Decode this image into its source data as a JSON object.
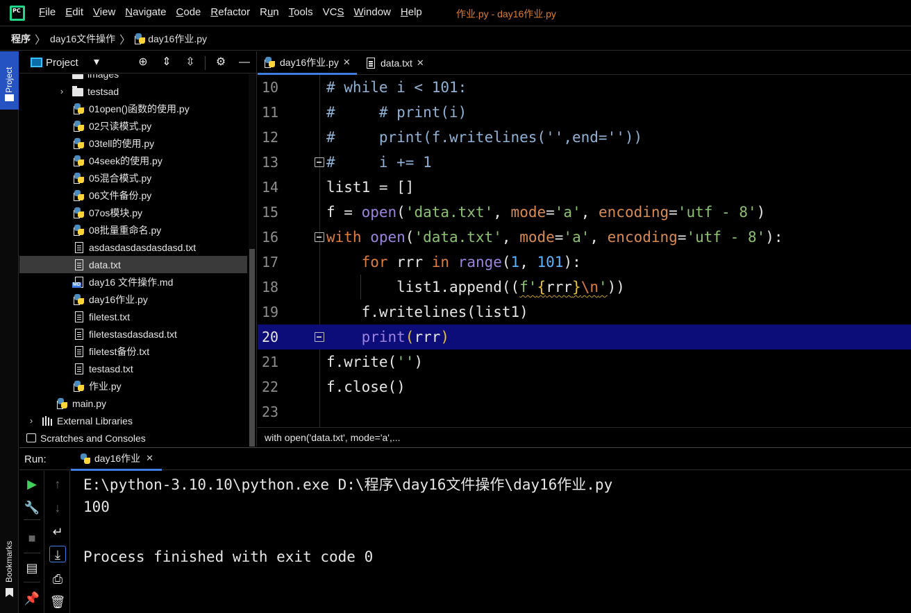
{
  "menu": {
    "logo": "PC",
    "items": [
      {
        "pre": "",
        "u": "F",
        "post": "ile"
      },
      {
        "pre": "",
        "u": "E",
        "post": "dit"
      },
      {
        "pre": "",
        "u": "V",
        "post": "iew"
      },
      {
        "pre": "",
        "u": "N",
        "post": "avigate"
      },
      {
        "pre": "",
        "u": "C",
        "post": "ode"
      },
      {
        "pre": "",
        "u": "R",
        "post": "efactor"
      },
      {
        "pre": "R",
        "u": "u",
        "post": "n"
      },
      {
        "pre": "",
        "u": "T",
        "post": "ools"
      },
      {
        "pre": "VC",
        "u": "S",
        "post": ""
      },
      {
        "pre": "",
        "u": "W",
        "post": "indow"
      },
      {
        "pre": "",
        "u": "H",
        "post": "elp"
      }
    ],
    "window_title": "作业.py - day16作业.py"
  },
  "breadcrumb": {
    "items": [
      "程序",
      "day16文件操作",
      "day16作业.py"
    ]
  },
  "sidebar": {
    "project_tab": "Project",
    "bookmarks_tab": "Bookmarks"
  },
  "project_panel": {
    "title": "Project",
    "tree": [
      {
        "label": "images",
        "type": "folder",
        "indent": 1,
        "arrow": "",
        "partial": true
      },
      {
        "label": "testsad",
        "type": "folder",
        "indent": 1,
        "arrow": "›"
      },
      {
        "label": "01open()函数的使用.py",
        "type": "py",
        "indent": 2
      },
      {
        "label": "02只读模式.py",
        "type": "py",
        "indent": 2
      },
      {
        "label": "03tell的使用.py",
        "type": "py",
        "indent": 2
      },
      {
        "label": "04seek的使用.py",
        "type": "py",
        "indent": 2
      },
      {
        "label": "05混合模式.py",
        "type": "py",
        "indent": 2
      },
      {
        "label": "06文件备份.py",
        "type": "py",
        "indent": 2
      },
      {
        "label": "07os模块.py",
        "type": "py",
        "indent": 2
      },
      {
        "label": "08批量重命名.py",
        "type": "py",
        "indent": 2
      },
      {
        "label": "asdasdasdasdasdasd.txt",
        "type": "txt",
        "indent": 2
      },
      {
        "label": "data.txt",
        "type": "txt",
        "indent": 2,
        "selected": true
      },
      {
        "label": "day16 文件操作.md",
        "type": "md",
        "indent": 2
      },
      {
        "label": "day16作业.py",
        "type": "py",
        "indent": 2
      },
      {
        "label": "filetest.txt",
        "type": "txt",
        "indent": 2
      },
      {
        "label": "filetestasdasdasd.txt",
        "type": "txt",
        "indent": 2
      },
      {
        "label": "filetest备份.txt",
        "type": "txt",
        "indent": 2
      },
      {
        "label": "testasd.txt",
        "type": "txt",
        "indent": 2
      },
      {
        "label": "作业.py",
        "type": "py",
        "indent": 2
      },
      {
        "label": "main.py",
        "type": "py",
        "indent": 1
      },
      {
        "label": "External Libraries",
        "type": "lib",
        "indent": 0,
        "arrow": "›"
      },
      {
        "label": "Scratches and Consoles",
        "type": "scratch",
        "indent": 0
      }
    ]
  },
  "editor": {
    "tabs": [
      {
        "label": "day16作业.py",
        "icon": "python-file-icon",
        "active": true
      },
      {
        "label": "data.txt",
        "icon": "text-file-icon",
        "active": false
      }
    ],
    "lines": [
      {
        "n": "10",
        "fold": false,
        "tokens": [
          [
            "c-comment",
            "# while i < 101:"
          ]
        ]
      },
      {
        "n": "11",
        "fold": false,
        "tokens": [
          [
            "c-comment",
            "#     # print(i)"
          ]
        ]
      },
      {
        "n": "12",
        "fold": false,
        "tokens": [
          [
            "c-comment",
            "#     print(f.writelines('',end=''))"
          ]
        ]
      },
      {
        "n": "13",
        "fold": true,
        "tokens": [
          [
            "c-comment",
            "#     i += 1"
          ]
        ]
      },
      {
        "n": "14",
        "fold": false,
        "tokens": [
          [
            "",
            "list1 = []"
          ]
        ]
      },
      {
        "n": "15",
        "fold": false,
        "tokens": [
          [
            "",
            "f = "
          ],
          [
            "c-builtin",
            "open"
          ],
          [
            "",
            "("
          ],
          [
            "c-str",
            "'data.txt'"
          ],
          [
            "",
            ", "
          ],
          [
            "c-param",
            "mode"
          ],
          [
            "",
            "="
          ],
          [
            "c-str",
            "'a'"
          ],
          [
            "",
            ", "
          ],
          [
            "c-param",
            "encoding"
          ],
          [
            "",
            "="
          ],
          [
            "c-str",
            "'utf - 8'"
          ],
          [
            "",
            ")"
          ]
        ]
      },
      {
        "n": "16",
        "fold": true,
        "tokens": [
          [
            "c-kw",
            "with "
          ],
          [
            "c-builtin",
            "open"
          ],
          [
            "",
            "("
          ],
          [
            "c-str",
            "'data.txt'"
          ],
          [
            "",
            ", "
          ],
          [
            "c-param",
            "mode"
          ],
          [
            "",
            "="
          ],
          [
            "c-str",
            "'a'"
          ],
          [
            "",
            ", "
          ],
          [
            "c-param",
            "encoding"
          ],
          [
            "",
            "="
          ],
          [
            "c-str",
            "'utf - 8'"
          ],
          [
            "",
            "):"
          ]
        ]
      },
      {
        "n": "17",
        "fold": false,
        "tokens": [
          [
            "",
            "    "
          ],
          [
            "c-kw",
            "for "
          ],
          [
            "",
            "rrr "
          ],
          [
            "c-kw",
            "in "
          ],
          [
            "c-builtin",
            "range"
          ],
          [
            "",
            "("
          ],
          [
            "c-num",
            "1"
          ],
          [
            "",
            ", "
          ],
          [
            "c-num",
            "101"
          ],
          [
            "",
            "):"
          ]
        ]
      },
      {
        "n": "18",
        "fold": false,
        "tokens": [
          [
            "",
            "        list1.append(("
          ],
          [
            "c-str squiggle",
            "f'"
          ],
          [
            "c-bracket squiggle",
            "{"
          ],
          [
            "squiggle",
            "rrr"
          ],
          [
            "c-bracket squiggle",
            "}"
          ],
          [
            "c-escape squiggle",
            "\\n"
          ],
          [
            "c-str squiggle",
            "'"
          ],
          [
            "",
            "))"
          ]
        ]
      },
      {
        "n": "19",
        "fold": false,
        "tokens": [
          [
            "",
            "    f.writelines(list1)"
          ]
        ]
      },
      {
        "n": "20",
        "fold": true,
        "current": true,
        "tokens": [
          [
            "",
            "    "
          ],
          [
            "c-builtin",
            "print"
          ],
          [
            "c-bracket",
            "("
          ],
          [
            "",
            "rrr"
          ],
          [
            "c-bracket",
            ")"
          ]
        ]
      },
      {
        "n": "21",
        "fold": false,
        "tokens": [
          [
            "",
            "f.write("
          ],
          [
            "c-str",
            "''"
          ],
          [
            "",
            ")"
          ]
        ]
      },
      {
        "n": "22",
        "fold": false,
        "tokens": [
          [
            "",
            "f.close()"
          ]
        ]
      },
      {
        "n": "23",
        "fold": false,
        "tokens": [
          [
            "",
            ""
          ]
        ]
      }
    ],
    "crumb": "with open('data.txt', mode='a',..."
  },
  "run": {
    "label": "Run:",
    "tab": "day16作业",
    "console": [
      "E:\\python-3.10.10\\python.exe D:\\程序\\day16文件操作\\day16作业.py",
      "100",
      "",
      "Process finished with exit code 0"
    ]
  },
  "colors": {
    "accent": "#3f7fe0",
    "current_line": "#0d0d7a",
    "title": "#e07c2c"
  }
}
